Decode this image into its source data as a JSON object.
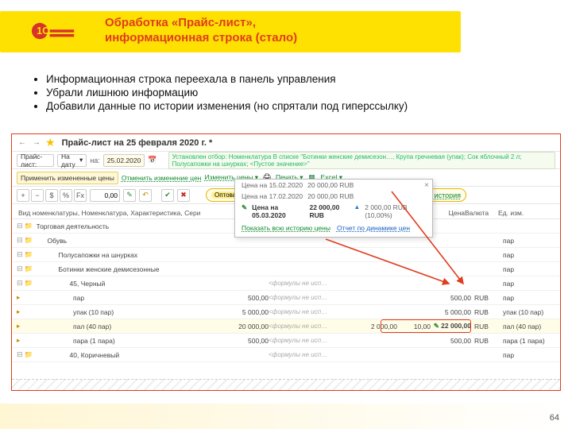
{
  "slide": {
    "title_line1": "Обработка «Прайс-лист»,",
    "title_line2": "информационная строка (стало)",
    "bullets": [
      "Информационная строка переехала в панель управления",
      "Убрали лишнюю информацию",
      "Добавили данные по истории изменения (но спрятали под гиперссылку)"
    ],
    "page": "64"
  },
  "app": {
    "window_title": "Прайс-лист на 25 февраля 2020 г. *",
    "toolbar": {
      "label_pricelist": "Прайс-лист:",
      "label_ondate": "На дату",
      "date": "25.02.2020",
      "filter_label": "Установлен отбор:",
      "filter_text": "Номенклатура В списке \"Ботинки женские демисезон…, Крупа гречневая (упак); Сок яблочный 2 л; Полусапожки на шнурках; <Пустое значение>\""
    },
    "cmdbar": {
      "apply": "Применить измененные цены",
      "undo": "Отменить изменение цен",
      "change": "Изменить цены",
      "print": "Печать",
      "excel": "Excel"
    },
    "fxbar": {
      "plus": "+",
      "minus": "−",
      "dollar": "$",
      "pct": "%",
      "fx": "Fx",
      "value": "0,00"
    },
    "summary": {
      "pill": "Оптовая76 (Оптовая)",
      "price": "22 000,00 RUB",
      "base": "2 000,00 RUB (10,00%)",
      "link": "история"
    },
    "popup": {
      "rows": [
        {
          "label": "Цена на 15.02.2020",
          "value": "20 000,00 RUB"
        },
        {
          "label": "Цена на 17.02.2020",
          "value": "20 000,00 RUB"
        },
        {
          "label": "Цена на 05.03.2020",
          "value": "22 000,00 RUB",
          "extra": "2 000,00 RUB (10,00%)",
          "bold": true
        }
      ],
      "link_history": "Показать всю историю цены",
      "link_report": "Отчет по динамике цен"
    },
    "grid_header": {
      "left": "Вид номенклатуры, Номенклатура, Характеристика, Сери",
      "price": "Цена",
      "currency": "Валюта",
      "unit": "Ед. изм."
    },
    "tree": [
      {
        "lvl": 0,
        "kind": "folder",
        "name": "Торговая деятельность"
      },
      {
        "lvl": 1,
        "kind": "folder",
        "name": "Обувь",
        "unit": "пар"
      },
      {
        "lvl": 2,
        "kind": "folder",
        "name": "Полусапожки на шнурках",
        "unit": "пар"
      },
      {
        "lvl": 2,
        "kind": "folder",
        "name": "Ботинки женские демисезонные",
        "unit": "пар"
      },
      {
        "lvl": 3,
        "kind": "folder",
        "name": "45, Черный",
        "formula": "<формулы не исп…",
        "unit": "пар"
      },
      {
        "lvl": 4,
        "kind": "leaf",
        "name": "пар",
        "n1": "500,00",
        "formula": "<формулы не исп…",
        "n3": "500,00",
        "cur": "RUB",
        "unit": "пар"
      },
      {
        "lvl": 4,
        "kind": "leaf",
        "name": "упак (10 пар)",
        "n1": "5 000,00",
        "formula": "<формулы не исп…",
        "n3": "5 000,00",
        "cur": "RUB",
        "unit": "упак (10 пар)"
      },
      {
        "lvl": 4,
        "kind": "leaf",
        "name": "пал (40 пар)",
        "n1": "20 000,00",
        "formula": "<формулы не исп…",
        "n2": "2 000,00",
        "pct": "10,00",
        "n3": "22 000,00",
        "cur": "RUB",
        "unit": "пал (40 пар)",
        "hot": true
      },
      {
        "lvl": 4,
        "kind": "leaf",
        "name": "пара (1 пара)",
        "n1": "500,00",
        "formula": "<формулы не исп…",
        "n3": "500,00",
        "cur": "RUB",
        "unit": "пара (1 пара)"
      },
      {
        "lvl": 3,
        "kind": "folder",
        "name": "40, Коричневый",
        "formula": "<формулы не исп…",
        "unit": "пар"
      }
    ]
  }
}
